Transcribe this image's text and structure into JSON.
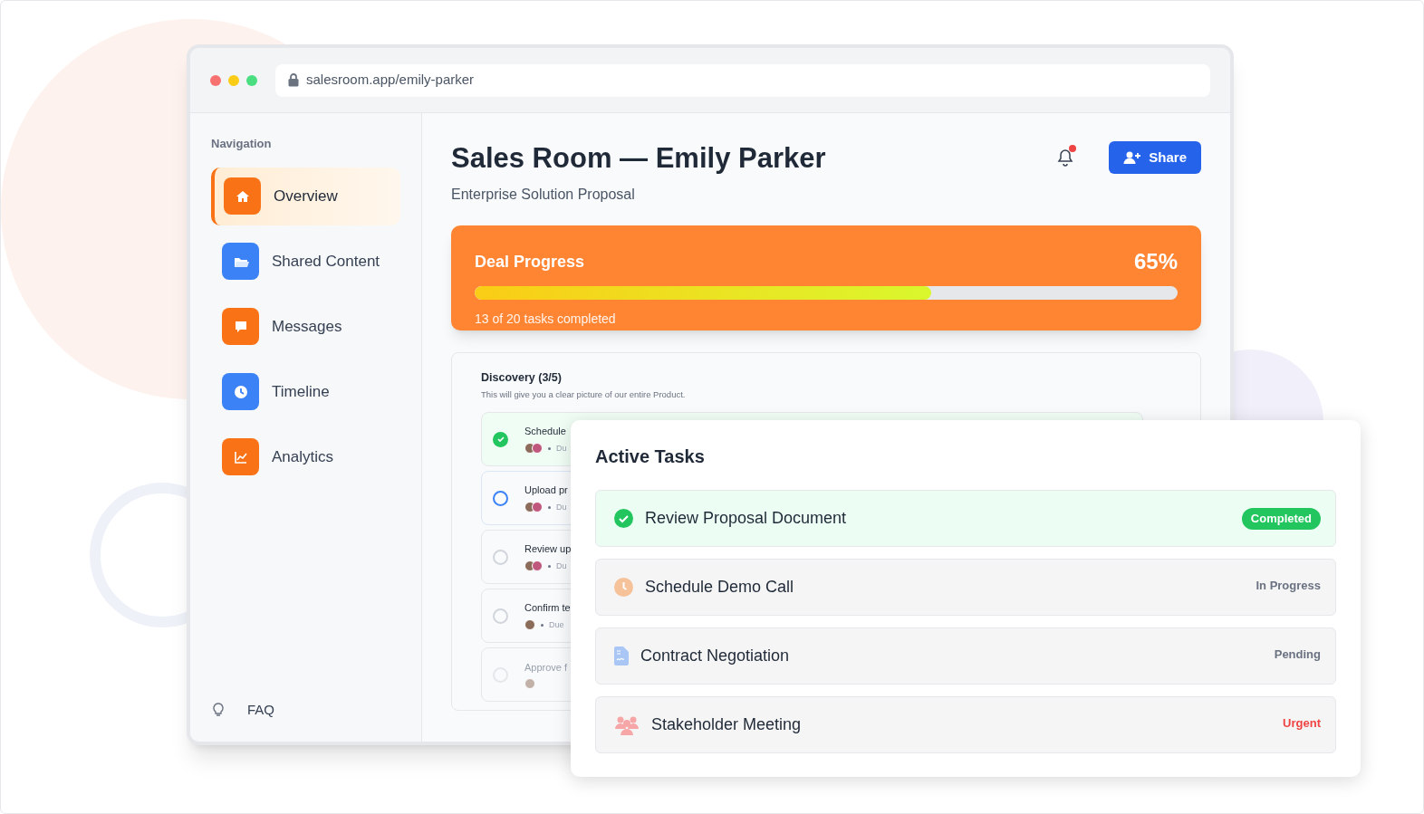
{
  "browser": {
    "url": "salesroom.app/emily-parker"
  },
  "sidebar": {
    "heading": "Navigation",
    "items": [
      {
        "label": "Overview",
        "color": "#f97316",
        "selected": true
      },
      {
        "label": "Shared Content",
        "color": "#3b82f6",
        "selected": false
      },
      {
        "label": "Messages",
        "color": "#f97316",
        "selected": false
      },
      {
        "label": "Timeline",
        "color": "#3b82f6",
        "selected": false
      },
      {
        "label": "Analytics",
        "color": "#f97316",
        "selected": false
      }
    ],
    "footer_link": "FAQ"
  },
  "header": {
    "title": "Sales Room — Emily Parker",
    "subtitle": "Enterprise Solution Proposal",
    "notification": true,
    "share_button": "Share"
  },
  "deal_progress": {
    "title": "Deal Progress",
    "percent": "65%",
    "level": 0.65,
    "caption": "13 of 20 tasks completed"
  },
  "discovery": {
    "title": "Discovery (3/5)",
    "description": "This will give you a clear picture of our entire Product.",
    "tasks": [
      {
        "title": "Schedule",
        "checked": true,
        "selected": false,
        "disabled": false,
        "due": "Du"
      },
      {
        "title": "Upload pr",
        "checked": false,
        "selected": true,
        "disabled": false,
        "due": "Du"
      },
      {
        "title": "Review up",
        "checked": false,
        "selected": false,
        "disabled": false,
        "due": "Du"
      },
      {
        "title": "Confirm te",
        "checked": false,
        "selected": false,
        "disabled": false,
        "due": "Due"
      },
      {
        "title": "Approve f",
        "checked": false,
        "selected": false,
        "disabled": true
      }
    ]
  },
  "active_tasks": {
    "title": "Active Tasks",
    "items": [
      {
        "name": "Review Proposal Document",
        "status": "Completed",
        "kind": "completed"
      },
      {
        "name": "Schedule Demo Call",
        "status": "In Progress",
        "kind": "progress"
      },
      {
        "name": "Contract Negotiation",
        "status": "Pending",
        "kind": "pending"
      },
      {
        "name": "Stakeholder Meeting",
        "status": "Urgent",
        "kind": "urgent"
      }
    ]
  }
}
